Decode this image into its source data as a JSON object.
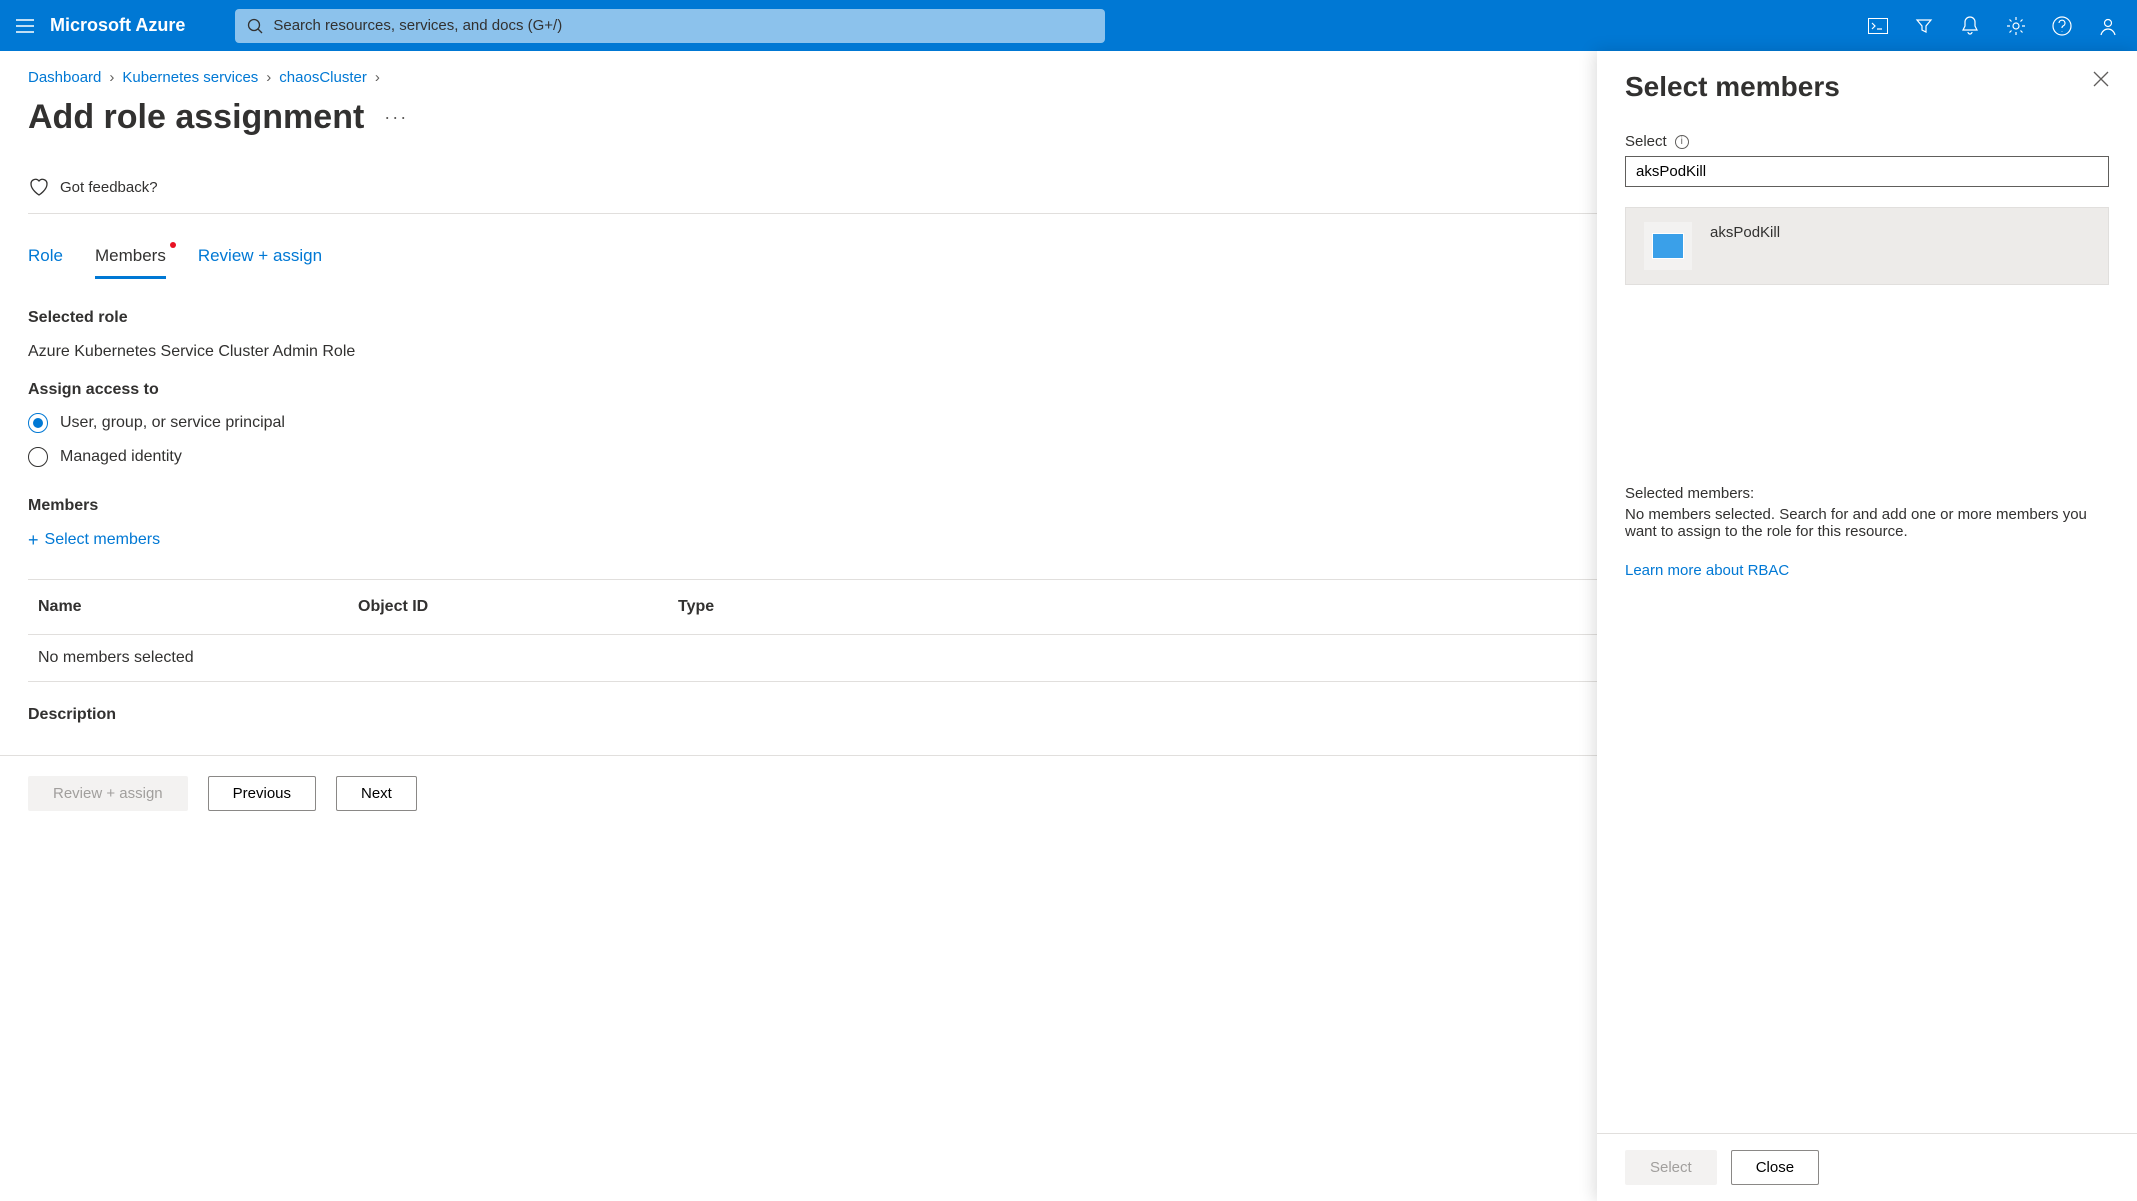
{
  "topbar": {
    "brand": "Microsoft Azure",
    "search_placeholder": "Search resources, services, and docs (G+/)"
  },
  "breadcrumb": {
    "items": [
      "Dashboard",
      "Kubernetes services",
      "chaosCluster"
    ]
  },
  "page": {
    "title": "Add role assignment",
    "feedback": "Got feedback?"
  },
  "tabs": {
    "role": "Role",
    "members": "Members",
    "review": "Review + assign"
  },
  "form": {
    "selected_role_label": "Selected role",
    "selected_role_value": "Azure Kubernetes Service Cluster Admin Role",
    "assign_label": "Assign access to",
    "radio1": "User, group, or service principal",
    "radio2": "Managed identity",
    "members_label": "Members",
    "select_members_link": "Select members",
    "description_label": "Description"
  },
  "table": {
    "col_name": "Name",
    "col_obj": "Object ID",
    "col_type": "Type",
    "empty": "No members selected"
  },
  "footer": {
    "review": "Review + assign",
    "previous": "Previous",
    "next": "Next"
  },
  "panel": {
    "title": "Select members",
    "select_label": "Select",
    "search_value": "aksPodKill",
    "result_name": "aksPodKill",
    "selected_label": "Selected members:",
    "selected_text": "No members selected. Search for and add one or more members you want to assign to the role for this resource.",
    "learn_link": "Learn more about RBAC",
    "select_btn": "Select",
    "close_btn": "Close"
  }
}
